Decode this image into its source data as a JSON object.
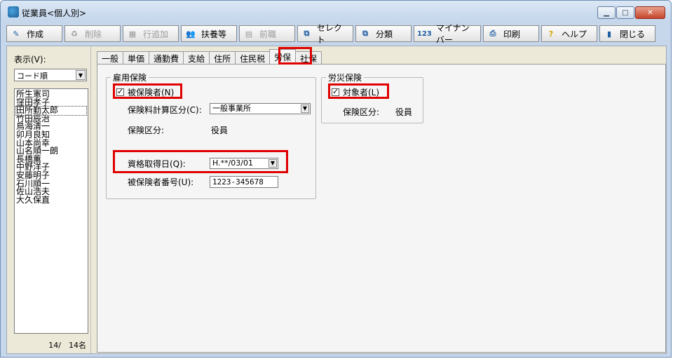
{
  "window": {
    "title": "従業員<個人別>"
  },
  "toolbar": {
    "buttons": [
      {
        "label": "作成",
        "icon": "create-icon"
      },
      {
        "label": "削除",
        "icon": "delete-icon"
      },
      {
        "label": "行追加",
        "icon": "add-row-icon"
      },
      {
        "label": "扶養等",
        "icon": "dependents-icon"
      },
      {
        "label": "前職",
        "icon": "previous-job-icon"
      },
      {
        "label": "セレクト",
        "icon": "select-icon"
      },
      {
        "label": "分類",
        "icon": "classify-icon"
      },
      {
        "label": "マイナンバー",
        "icon": "my-number-icon",
        "prefix": "123"
      },
      {
        "label": "印刷",
        "icon": "print-icon"
      },
      {
        "label": "ヘルプ",
        "icon": "help-icon"
      },
      {
        "label": "閉じる",
        "icon": "close-door-icon"
      }
    ]
  },
  "sidebar": {
    "display_label": "表示(V):",
    "sort_value": "コード順",
    "employees": [
      "所生憲司",
      "窪田孝子",
      "田所勤太郎",
      "竹田辰治",
      "鳥海清一",
      "卯月良知",
      "山本尚幸",
      "山名順一朗",
      "長橋薫",
      "中野洋子",
      "安藤明子",
      "石川順一",
      "佐山浩夫",
      "大久保直"
    ],
    "count": "14/　14名"
  },
  "tabs": [
    "一般",
    "単価",
    "通勤費",
    "支給",
    "住所",
    "住民税",
    "労保",
    "社保"
  ],
  "active_tab": "労保",
  "koyo": {
    "title": "雇用保険",
    "insured_label": "被保険者(N)",
    "calc_label": "保険料計算区分(C):",
    "calc_value": "一般事業所",
    "category_label": "保険区分:",
    "category_value": "役員",
    "acquired_label": "資格取得日(Q):",
    "acquired_value": "H.**/03/01",
    "number_label": "被保険者番号(U):",
    "number_value": "1223-345678"
  },
  "rousai": {
    "title": "労災保険",
    "target_label": "対象者(L)",
    "category_label": "保険区分:",
    "category_value": "役員"
  },
  "colors": {
    "highlight": "#e00000",
    "titlebar": "#c6d7ec"
  }
}
